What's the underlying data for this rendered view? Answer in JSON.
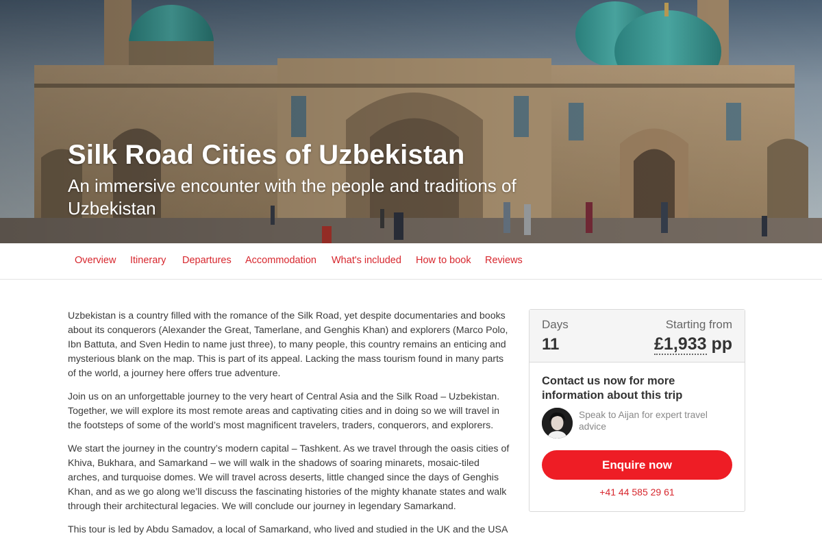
{
  "hero": {
    "title": "Silk Road Cities of Uzbekistan",
    "subtitle": "An immersive encounter with the people and traditions of Uzbekistan"
  },
  "nav": {
    "items": [
      "Overview",
      "Itinerary",
      "Departures",
      "Accommodation",
      "What's included",
      "How to book",
      "Reviews"
    ]
  },
  "content": {
    "paragraphs": [
      "Uzbekistan is a country filled with the romance of the Silk Road, yet despite documentaries and books about its conquerors (Alexander the Great, Tamerlane, and Genghis Khan) and explorers (Marco Polo, Ibn Battuta, and Sven Hedin to name just three), to many people, this country remains an enticing and mysterious blank on the map. This is part of its appeal. Lacking the mass tourism found in many parts of the world, a journey here offers true adventure.",
      "Join us on an unforgettable journey to the very heart of Central Asia and the Silk Road – Uzbekistan. Together, we will explore its most remote areas and captivating cities and in doing so we will travel in the footsteps of some of the world’s most magnificent travelers, traders, conquerors, and explorers.",
      "We start the journey in the country’s modern capital – Tashkent. As we travel through the oasis cities of Khiva, Bukhara, and Samarkand – we will walk in the shadows of soaring minarets, mosaic-tiled arches, and turquoise domes. We will travel across deserts, little changed since the days of Genghis Khan, and as we go along we’ll discuss the fascinating histories of the mighty khanate states and walk through their architectural legacies. We will conclude our journey in legendary Samarkand.",
      "This tour is led by Abdu Samadov, a local of Samarkand, who lived and studied in the UK and the USA"
    ]
  },
  "card": {
    "days_label": "Days",
    "days_value": "11",
    "from_label": "Starting from",
    "price_amount": "£1,933",
    "price_suffix": "pp",
    "contact_heading": "Contact us now for more information about this trip",
    "speak_text": "Speak to Aijan for expert travel advice",
    "enquire_label": "Enquire now",
    "phone": "+41 44 585 29 61"
  },
  "colors": {
    "accent": "#d7262d",
    "button": "#ee1d25",
    "dome": "#3f9f9a"
  }
}
